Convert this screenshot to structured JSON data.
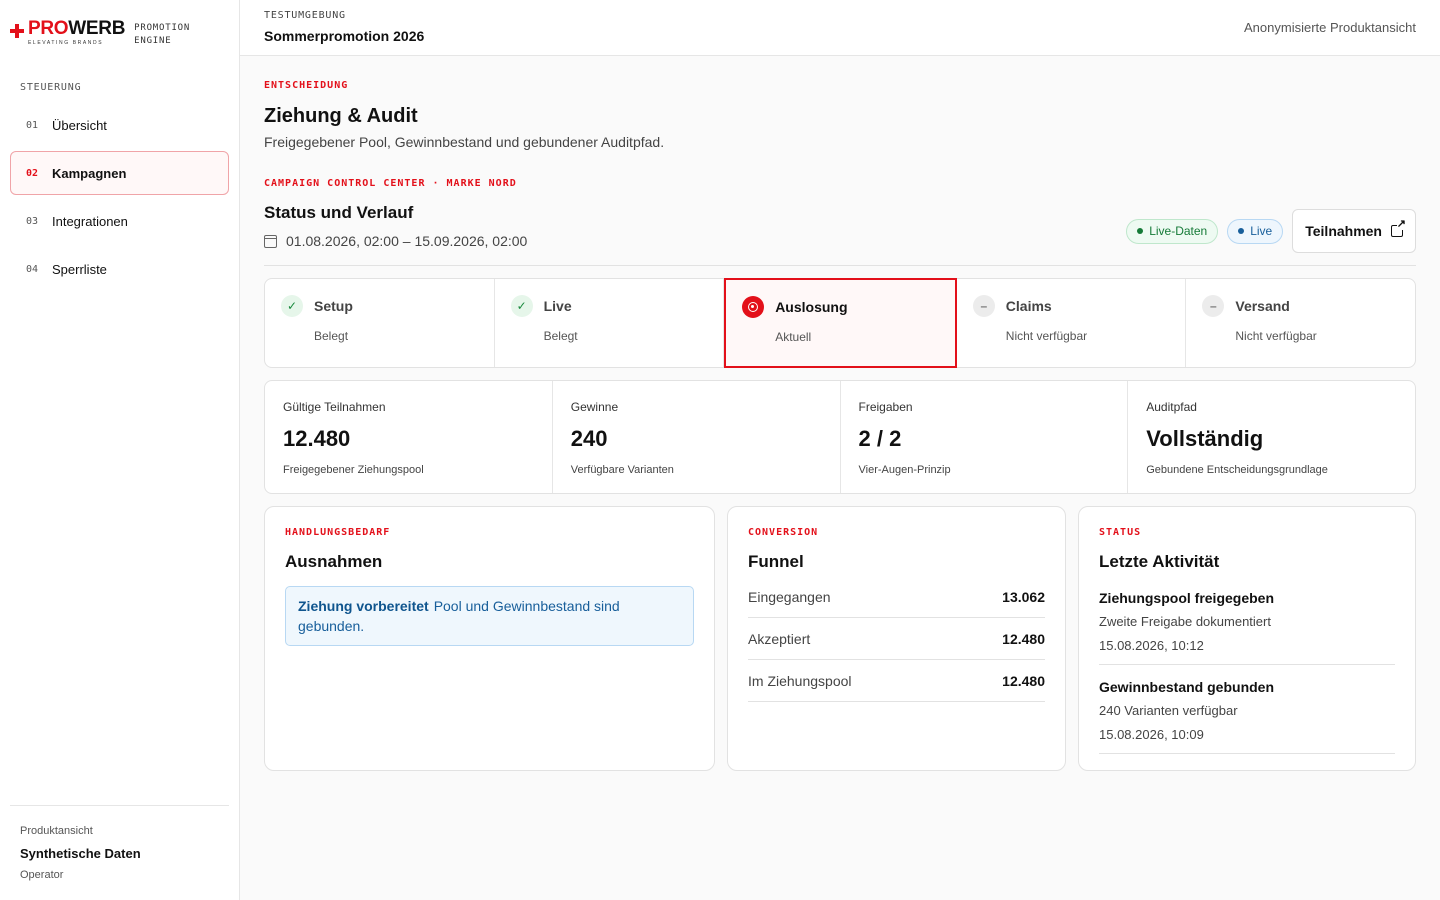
{
  "brand": {
    "name_red": "PRO",
    "name_dark": "WERB",
    "tagline": "ELEVATING BRANDS",
    "engine_label": "PROMOTION ENGINE"
  },
  "sidebar": {
    "heading": "STEUERUNG",
    "items": [
      {
        "num": "01",
        "label": "Übersicht"
      },
      {
        "num": "02",
        "label": "Kampagnen"
      },
      {
        "num": "03",
        "label": "Integrationen"
      },
      {
        "num": "04",
        "label": "Sperrliste"
      }
    ],
    "footer": {
      "label": "Produktansicht",
      "title": "Synthetische Daten",
      "role": "Operator"
    }
  },
  "topbar": {
    "env_label": "TESTUMGEBUNG",
    "env_title": "Sommerpromotion 2026",
    "right_text": "Anonymisierte Produktansicht"
  },
  "section": {
    "eyebrow": "ENTSCHEIDUNG",
    "title": "Ziehung & Audit",
    "subtitle": "Freigegebener Pool, Gewinnbestand und gebundener Auditpfad."
  },
  "status": {
    "eyebrow": "CAMPAIGN CONTROL CENTER · MARKE NORD",
    "title": "Status und Verlauf",
    "date_range": "01.08.2026, 02:00 – 15.09.2026, 02:00",
    "pill_live_data": "Live-Daten",
    "pill_live": "Live",
    "button_label": "Teilnahmen",
    "colors": {
      "accent": "#e3101a",
      "green": "#157a37",
      "blue": "#175e9a"
    }
  },
  "steps": [
    {
      "name": "Setup",
      "sub": "Belegt",
      "state": "done"
    },
    {
      "name": "Live",
      "sub": "Belegt",
      "state": "done"
    },
    {
      "name": "Auslosung",
      "sub": "Aktuell",
      "state": "current"
    },
    {
      "name": "Claims",
      "sub": "Nicht verfügbar",
      "state": "unavailable"
    },
    {
      "name": "Versand",
      "sub": "Nicht verfügbar",
      "state": "unavailable"
    }
  ],
  "kpis": [
    {
      "label": "Gültige Teilnahmen",
      "value": "12.480",
      "sub": "Freigegebener Ziehungspool"
    },
    {
      "label": "Gewinne",
      "value": "240",
      "sub": "Verfügbare Varianten"
    },
    {
      "label": "Freigaben",
      "value": "2 / 2",
      "sub": "Vier-Augen-Prinzip"
    },
    {
      "label": "Auditpfad",
      "value": "Vollständig",
      "sub": "Gebundene Entscheidungsgrundlage"
    }
  ],
  "exceptions": {
    "eyebrow": "HANDLUNGSBEDARF",
    "title": "Ausnahmen",
    "notice_title": "Ziehung vorbereitet",
    "notice_text": "Pool und Gewinnbestand sind gebunden."
  },
  "funnel": {
    "eyebrow": "CONVERSION",
    "title": "Funnel",
    "rows": [
      {
        "label": "Eingegangen",
        "value": "13.062"
      },
      {
        "label": "Akzeptiert",
        "value": "12.480"
      },
      {
        "label": "Im Ziehungspool",
        "value": "12.480"
      }
    ]
  },
  "activity": {
    "eyebrow": "STATUS",
    "title": "Letzte Aktivität",
    "items": [
      {
        "title": "Ziehungspool freigegeben",
        "desc": "Zweite Freigabe dokumentiert",
        "time": "15.08.2026, 10:12"
      },
      {
        "title": "Gewinnbestand gebunden",
        "desc": "240 Varianten verfügbar",
        "time": "15.08.2026, 10:09"
      }
    ]
  }
}
